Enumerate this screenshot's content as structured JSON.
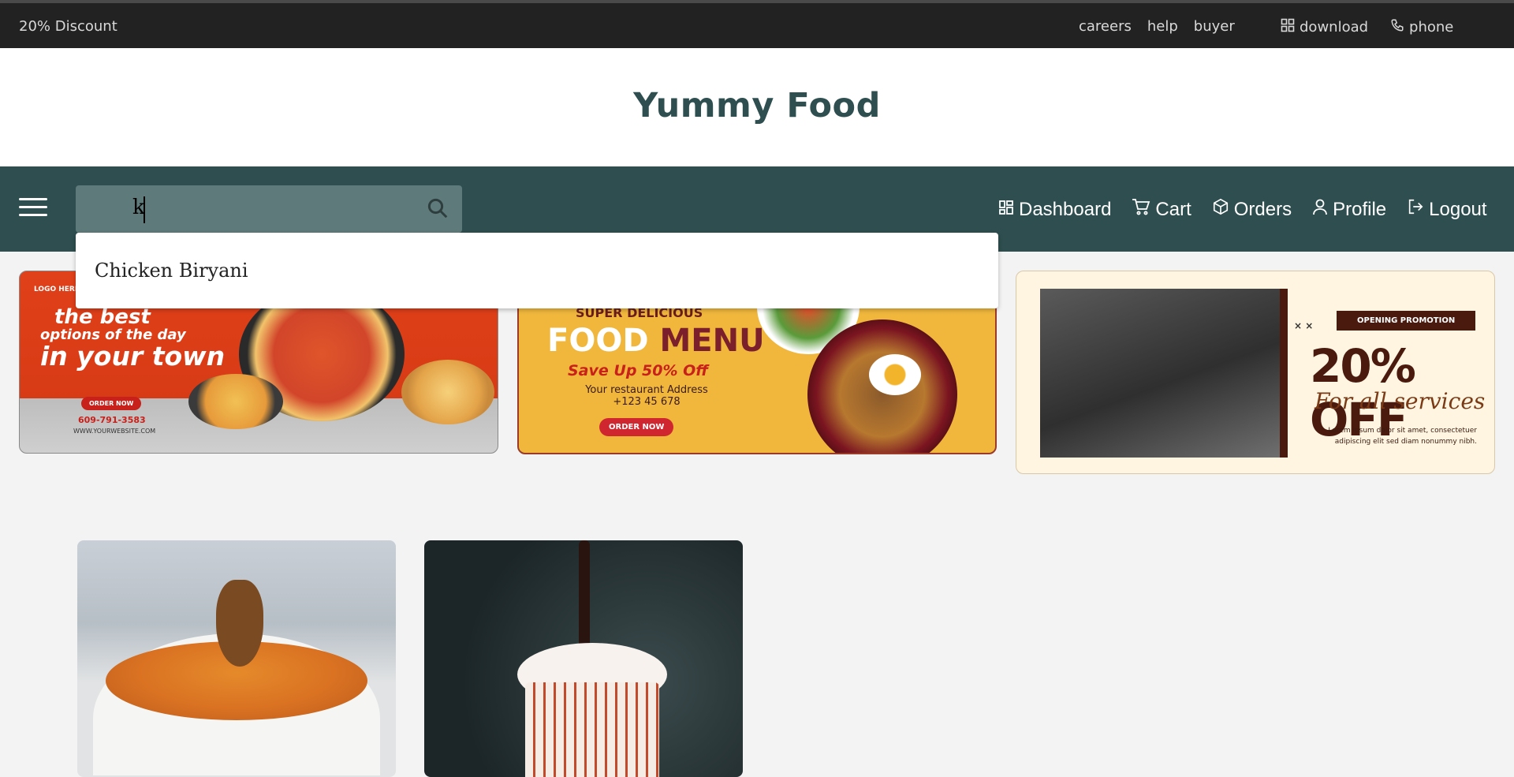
{
  "topbar": {
    "promo": "20% Discount",
    "links": [
      "careers",
      "help",
      "buyer"
    ],
    "download": "download",
    "phone": "phone"
  },
  "brand": {
    "title": "Yummy Food"
  },
  "nav": {
    "search_value": "k",
    "menu": {
      "dashboard": "Dashboard",
      "cart": "Cart",
      "orders": "Orders",
      "profile": "Profile",
      "logout": "Logout"
    }
  },
  "suggestions": [
    "Chicken Biryani"
  ],
  "banners": {
    "b1": {
      "logo": "LOGO HERE",
      "line1": "the best",
      "line2": "options of the day",
      "line3": "in your town",
      "cta": "ORDER NOW",
      "phone": "609-791-3583",
      "web": "WWW.YOURWEBSITE.COM"
    },
    "b2": {
      "kicker": "SUPER DELICIOUS",
      "food": "FOOD",
      "menu": "MENU",
      "save": "Save Up 50% Off",
      "address": "Your restaurant Address",
      "phone": "+123 45 678",
      "cta": "ORDER NOW"
    },
    "b3": {
      "tag": "OPENING PROMOTION",
      "percent": "20% OFF",
      "sub": "For all services",
      "body": "Lorem ipsum dolor sit amet, consectetuer adipiscing elit sed diam nonummy nibh."
    }
  },
  "colors": {
    "topbar": "#222222",
    "nav": "#2e4e4f",
    "brand_text": "#2e4e4f",
    "search_bg": "#5f7a7a",
    "page_bg": "#f3f3f3"
  }
}
